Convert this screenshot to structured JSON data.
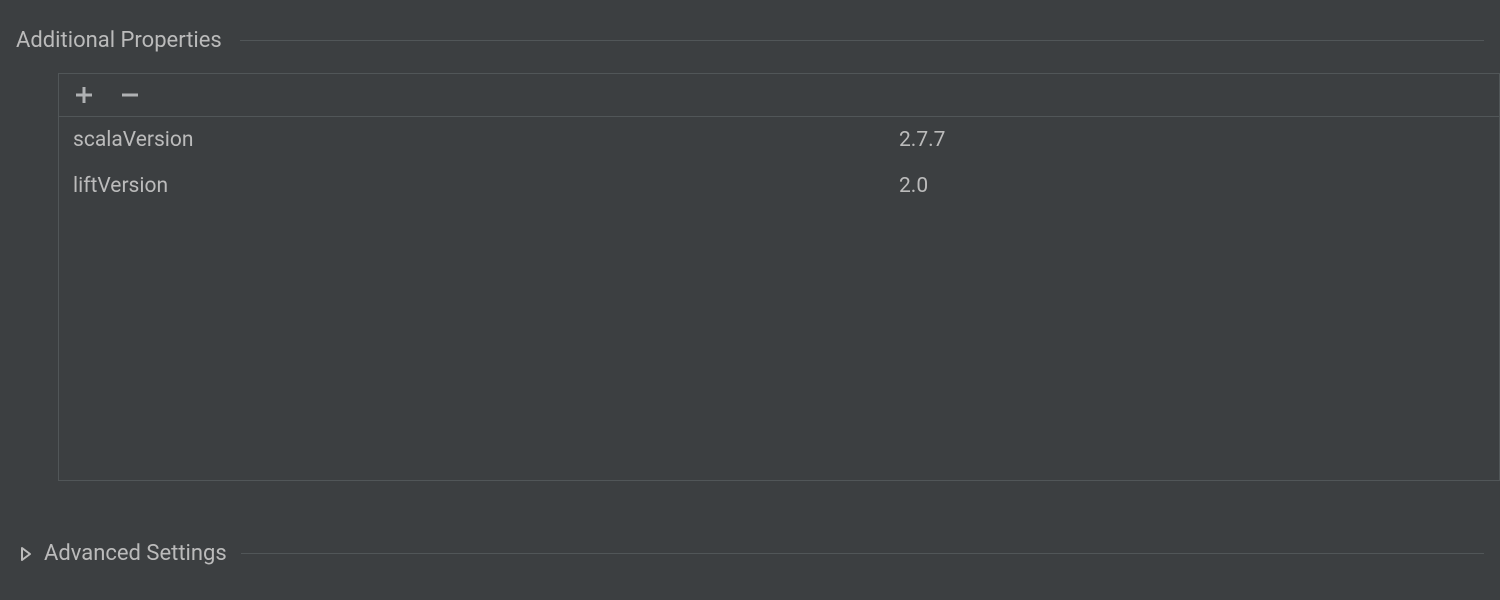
{
  "sections": {
    "additionalProperties": {
      "title": "Additional Properties",
      "rows": [
        {
          "key": "scalaVersion",
          "value": "2.7.7"
        },
        {
          "key": "liftVersion",
          "value": "2.0"
        }
      ]
    },
    "advanced": {
      "title": "Advanced Settings"
    }
  },
  "icons": {
    "add": "plus-icon",
    "remove": "minus-icon",
    "chevron": "chevron-right-icon"
  },
  "colors": {
    "background": "#3c3f41",
    "border": "#515658",
    "text": "#bbbbbb",
    "icon": "#afb1b3"
  }
}
